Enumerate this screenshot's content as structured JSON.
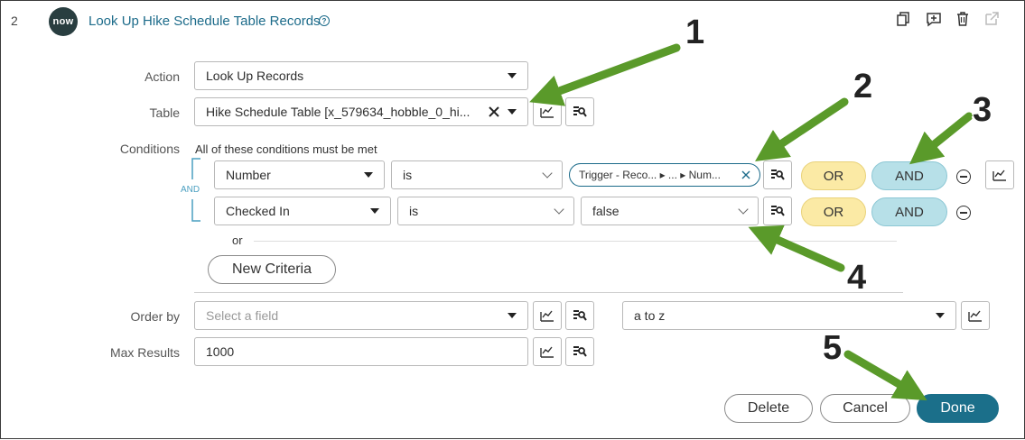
{
  "header": {
    "step_number": "2",
    "logo_text": "now",
    "title": "Look Up Hike Schedule Table Records",
    "help_glyph": "?"
  },
  "form": {
    "action_label": "Action",
    "action_value": "Look Up Records",
    "table_label": "Table",
    "table_value": "Hike Schedule Table [x_579634_hobble_0_hi...",
    "conditions_label": "Conditions",
    "conditions_help": "All of these conditions must be met",
    "group_and_label": "AND",
    "conditions": [
      {
        "field": "Number",
        "operator": "is",
        "value_pill": "Trigger - Reco... ▸ ... ▸ Num...",
        "or_label": "OR",
        "and_label": "AND"
      },
      {
        "field": "Checked In",
        "operator": "is",
        "value": "false",
        "or_label": "OR",
        "and_label": "AND"
      }
    ],
    "or_separator": "or",
    "new_criteria_label": "New Criteria",
    "order_by_label": "Order by",
    "order_by_placeholder": "Select a field",
    "sort_value": "a to z",
    "max_results_label": "Max Results",
    "max_results_value": "1000"
  },
  "footer": {
    "delete_label": "Delete",
    "cancel_label": "Cancel",
    "done_label": "Done"
  },
  "annotations": {
    "n1": "1",
    "n2": "2",
    "n3": "3",
    "n4": "4",
    "n5": "5",
    "arrow_color": "#5a9a2a"
  },
  "colors": {
    "brand": "#1b6f8a",
    "or_pill": "#fbeaa5",
    "and_pill": "#b7e0e8"
  }
}
